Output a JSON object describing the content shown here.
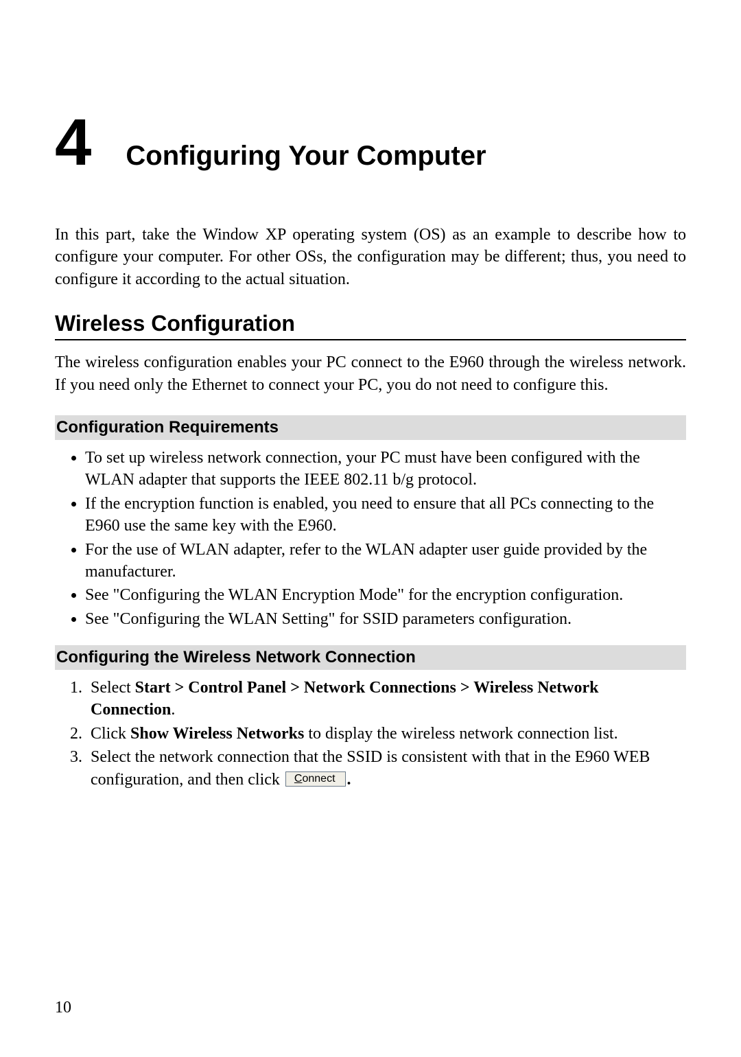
{
  "chapter": {
    "number": "4",
    "title": "Configuring Your Computer"
  },
  "intro_paragraph": "In this part, take the Window XP operating system (OS) as an example to describe how to configure your computer. For other OSs, the configuration may be different; thus, you need to configure it according to the actual situation.",
  "section": {
    "title": "Wireless Configuration",
    "intro": "The wireless configuration enables your PC connect to the E960 through the wireless network. If you need only the Ethernet to connect your PC, you do not need to configure this."
  },
  "subsections": {
    "requirements": {
      "title": "Configuration Requirements",
      "bullets": [
        "To set up wireless network connection, your PC must have been configured with the WLAN adapter that supports the IEEE 802.11 b/g protocol.",
        "If the encryption function is enabled, you need to ensure that all PCs connecting to the E960 use the same key with the E960.",
        "For the use of WLAN adapter, refer to the WLAN adapter user guide provided by the manufacturer.",
        "See \"Configuring the WLAN Encryption Mode\" for the encryption configuration.",
        "See \"Configuring the WLAN Setting\" for SSID parameters configuration."
      ]
    },
    "connection": {
      "title": "Configuring the Wireless Network Connection",
      "steps": {
        "s1_prefix": "Select ",
        "s1_bold": "Start > Control Panel > Network Connections > Wireless Network Connection",
        "s1_suffix": ".",
        "s2_prefix": "Click ",
        "s2_bold": "Show Wireless Networks",
        "s2_suffix": " to display the wireless network connection list.",
        "s3_prefix": "Select the network connection that the SSID is consistent with that in the E960 WEB configuration, and then click",
        "s3_btn_access": "C",
        "s3_btn_rest": "onnect",
        "s3_suffix": "."
      }
    }
  },
  "page_number": "10"
}
